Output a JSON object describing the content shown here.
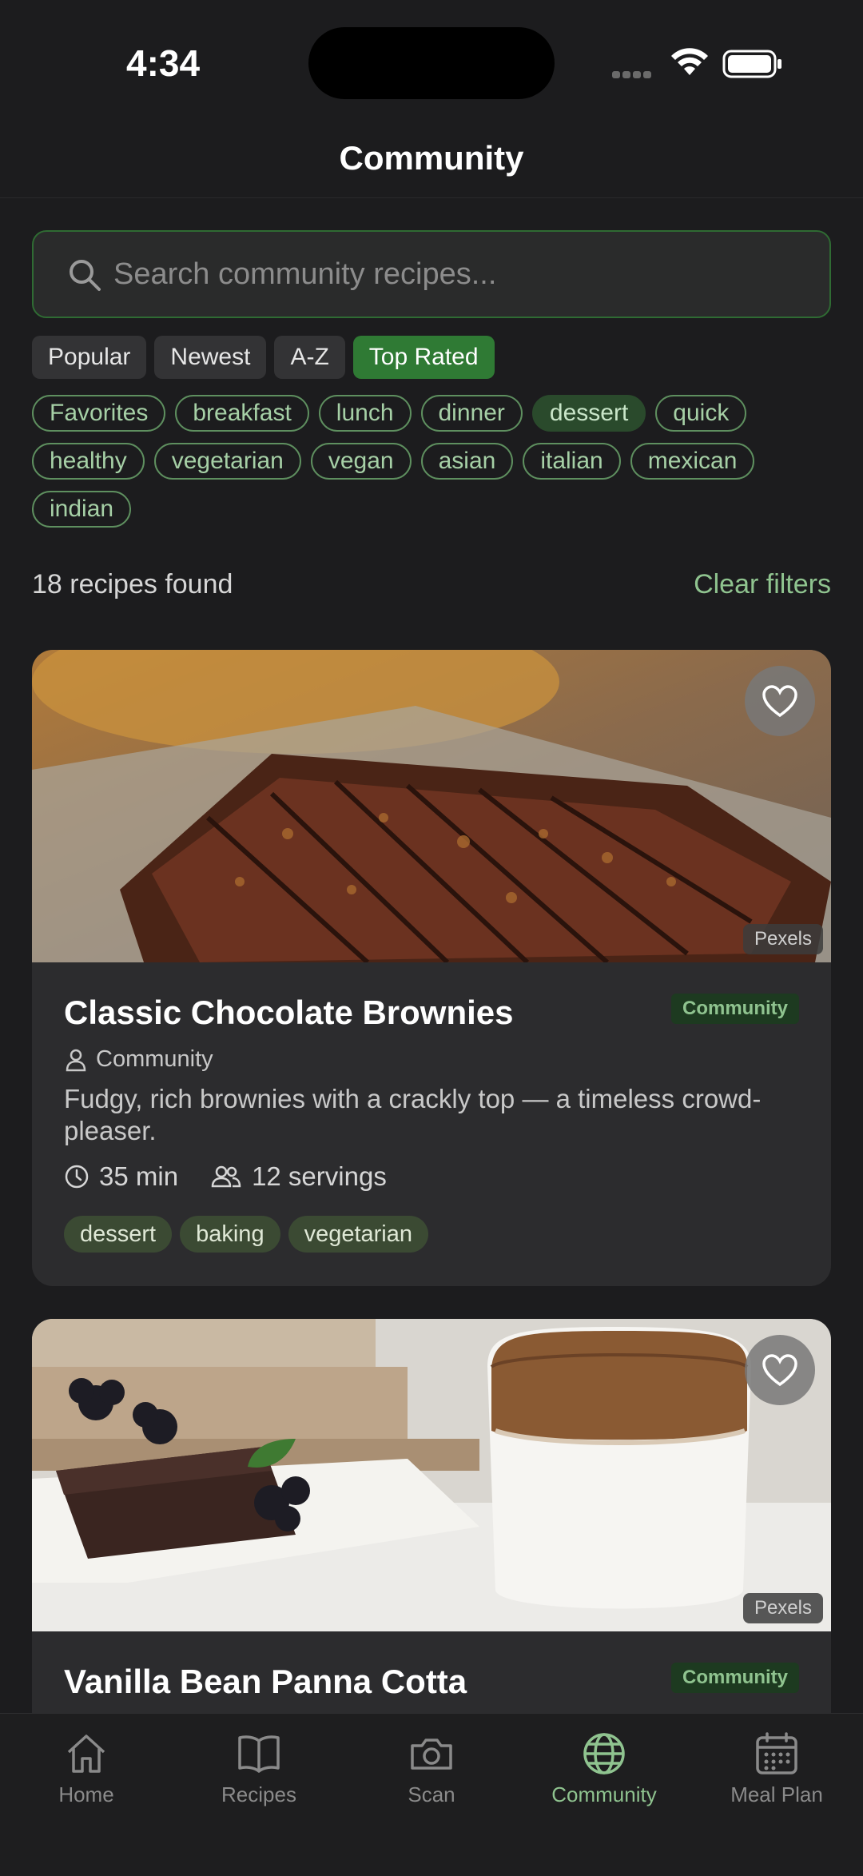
{
  "status_bar": {
    "time": "4:34"
  },
  "header": {
    "title": "Community"
  },
  "search": {
    "placeholder": "Search community recipes..."
  },
  "sort_options": [
    "Popular",
    "Newest",
    "A-Z",
    "Top Rated"
  ],
  "sort_selected": "Top Rated",
  "tags": [
    "Favorites",
    "breakfast",
    "lunch",
    "dinner",
    "dessert",
    "quick",
    "healthy",
    "vegetarian",
    "vegan",
    "asian",
    "italian",
    "mexican",
    "indian"
  ],
  "tag_selected": "dessert",
  "results": {
    "count_text": "18 recipes found",
    "clear_label": "Clear filters"
  },
  "recipes": [
    {
      "title": "Classic Chocolate Brownies",
      "badge": "Community",
      "author": "Community",
      "description": "Fudgy, rich brownies with a crackly top — a timeless crowd-pleaser.",
      "time": "35 min",
      "servings": "12 servings",
      "tags": [
        "dessert",
        "baking",
        "vegetarian"
      ],
      "image_credit": "Pexels"
    },
    {
      "title": "Vanilla Bean Panna Cotta",
      "badge": "Community",
      "image_credit": "Pexels"
    }
  ],
  "tab_bar": {
    "items": [
      "Home",
      "Recipes",
      "Scan",
      "Community",
      "Meal Plan"
    ],
    "active": "Community"
  },
  "colors": {
    "accent": "#2f7a34",
    "accent_text": "#8fc38f",
    "background": "#1c1c1e",
    "card": "#2c2c2e"
  }
}
